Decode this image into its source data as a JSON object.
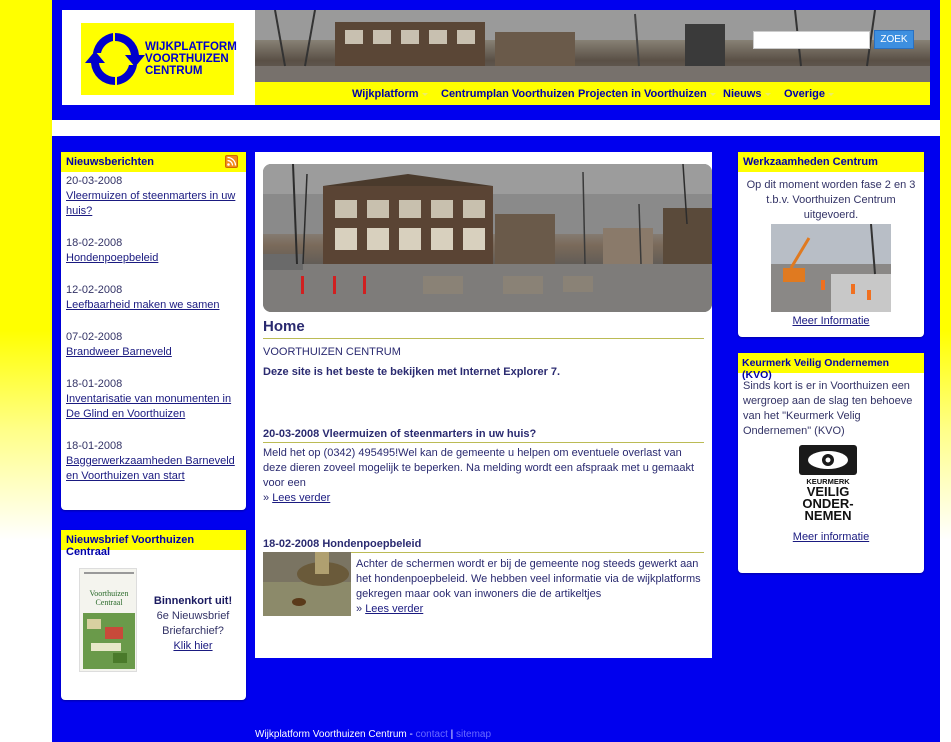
{
  "header": {
    "logo_lines": [
      "WIJKPLATFORM",
      "VOORTHUIZEN",
      "CENTRUM"
    ],
    "search_placeholder": "",
    "search_button": "ZOEK"
  },
  "nav": {
    "items": [
      {
        "label": "Wijkplatform",
        "has_dropdown": true
      },
      {
        "label": "Centrumplan Voorthuizen",
        "has_dropdown": false
      },
      {
        "label": "Projecten in Voorthuizen",
        "has_dropdown": true
      },
      {
        "label": "Nieuws",
        "has_dropdown": true
      },
      {
        "label": "Overige",
        "has_dropdown": true
      }
    ]
  },
  "news": {
    "title": "Nieuwsberichten",
    "items": [
      {
        "date": "20-03-2008",
        "title": "Vleermuizen of steenmarters in uw huis?"
      },
      {
        "date": "18-02-2008",
        "title": "Hondenpoepbeleid"
      },
      {
        "date": "12-02-2008",
        "title": "Leefbaarheid maken we samen"
      },
      {
        "date": "07-02-2008",
        "title": "Brandweer Barneveld"
      },
      {
        "date": "18-01-2008",
        "title": "Inventarisatie van monumenten in De Glind en Voorthuizen"
      },
      {
        "date": "18-01-2008",
        "title": "Baggerwerkzaamheden Barneveld en Voorthuizen van start"
      }
    ]
  },
  "newsletter": {
    "title": "Nieuwsbrief Voorthuizen Centraal",
    "thumb_label": "Voorthuizen Centraal",
    "line1": "Binnenkort uit!",
    "line2": "6e Nieuwsbrief",
    "line3": "Briefarchief?",
    "link": "Klik hier"
  },
  "main": {
    "title": "Home",
    "subtitle": "VOORTHUIZEN CENTRUM",
    "ie_note": "Deze site is het beste te bekijken met Internet Explorer 7.",
    "articles": [
      {
        "title": "20-03-2008 Vleermuizen of steenmarters in uw huis?",
        "text": "Meld het op (0342) 495495!Wel kan de gemeente u helpen om eventuele overlast van deze dieren zoveel mogelijk te beperken. Na melding wordt een afspraak met u gemaakt voor een",
        "more": "Lees verder"
      },
      {
        "title": "18-02-2008 Hondenpoepbeleid",
        "text": "Achter de schermen wordt er bij de gemeente nog steeds gewerkt aan het hondenpoepbeleid. We hebben veel informatie via de wijkplatforms gekregen maar ook van inwoners die de artikeltjes",
        "more": "Lees verder"
      }
    ]
  },
  "werk": {
    "title": "Werkzaamheden Centrum",
    "text": "Op dit moment worden fase 2 en 3 t.b.v. Voorthuizen Centrum uitgevoerd.",
    "link": "Meer Informatie"
  },
  "kvo": {
    "title": "Keurmerk Veilig Ondernemen (KVO)",
    "text": "Sinds kort is er in Voorthuizen een wergroep aan de slag ten behoeve van het \"Keurmerk Velig Ondernemen\" (KVO)",
    "logo_lines": [
      "KEURMERK",
      "VEILIG",
      "ONDER-",
      "NEMEN"
    ],
    "link": "Meer informatie"
  },
  "footer": {
    "text": "Wijkplatform Voorthuizen Centrum - ",
    "contact": "contact",
    "separator": " | ",
    "sitemap": "sitemap"
  },
  "colors": {
    "page_blue": "#0000ee",
    "yellow": "#ffff00",
    "title_blue": "#0000aa",
    "search_button": "#3d8fe0"
  }
}
